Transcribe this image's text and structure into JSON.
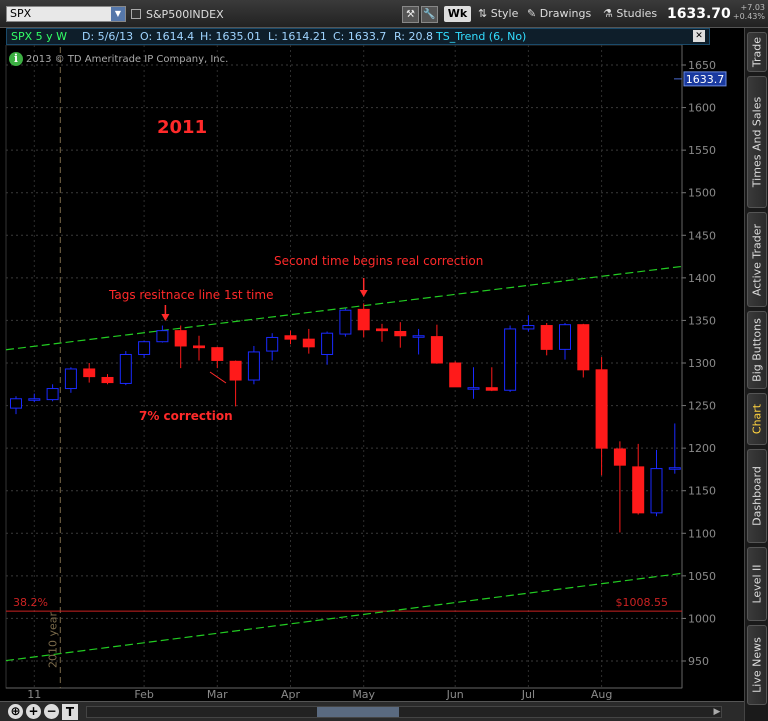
{
  "toolbar": {
    "symbol": "SPX",
    "symbol_description": "S&P500INDEX",
    "aggregation_button": "Wk",
    "style_label": "Style",
    "drawings_label": "Drawings",
    "studies_label": "Studies",
    "last_price": "1633.70",
    "net_change": "+7.03",
    "pct_change": "+0.43%"
  },
  "infobar": {
    "symbol_period": "SPX 5 y W",
    "date": "D: 5/6/13",
    "open": "O: 1614.4",
    "high": "H: 1635.01",
    "low": "L: 1614.21",
    "close": "C: 1633.7",
    "range": "R: 20.8",
    "study": "TS_Trend (6, No)"
  },
  "copyright": "2013 © TD Ameritrade IP Company, Inc.",
  "side_tabs": [
    "Trade",
    "Times And Sales",
    "Active Trader",
    "Big Buttons",
    "Chart",
    "Dashboard",
    "Level II",
    "Live News"
  ],
  "active_side_tab": "Chart",
  "colors": {
    "up_candle": "#1a2aff",
    "down_candle": "#ff1a1a",
    "trend_line": "#22cc22",
    "fib_line": "#cc2222",
    "price_axis_text": "#8a8a8a",
    "annotation_text": "#ff2a2a",
    "price_label_bg": "#1a3aa0"
  },
  "chart_data": {
    "type": "candlestick",
    "title": "2011",
    "ylim": [
      930,
      1665
    ],
    "y_ticks": [
      950,
      1000,
      1050,
      1100,
      1150,
      1200,
      1250,
      1300,
      1350,
      1400,
      1450,
      1500,
      1550,
      1600,
      1650
    ],
    "x_tick_labels": [
      "11",
      "Feb",
      "Mar",
      "Apr",
      "May",
      "Jun",
      "Jul",
      "Aug"
    ],
    "x_tick_bar_index": [
      1,
      7,
      11,
      15,
      19,
      24,
      28,
      32
    ],
    "current_price_label": "1633.7",
    "grid": true,
    "candles": [
      {
        "o": 1247,
        "h": 1261,
        "l": 1240,
        "c": 1258
      },
      {
        "o": 1257,
        "h": 1264,
        "l": 1254,
        "c": 1258
      },
      {
        "o": 1257,
        "h": 1275,
        "l": 1255,
        "c": 1270
      },
      {
        "o": 1270,
        "h": 1295,
        "l": 1265,
        "c": 1293
      },
      {
        "o": 1293,
        "h": 1300,
        "l": 1277,
        "c": 1284
      },
      {
        "o": 1283,
        "h": 1287,
        "l": 1275,
        "c": 1277
      },
      {
        "o": 1276,
        "h": 1314,
        "l": 1274,
        "c": 1310
      },
      {
        "o": 1310,
        "h": 1326,
        "l": 1306,
        "c": 1325
      },
      {
        "o": 1325,
        "h": 1344,
        "l": 1324,
        "c": 1338
      },
      {
        "o": 1338,
        "h": 1344,
        "l": 1294,
        "c": 1320
      },
      {
        "o": 1320,
        "h": 1332,
        "l": 1303,
        "c": 1318
      },
      {
        "o": 1318,
        "h": 1319,
        "l": 1294,
        "c": 1303
      },
      {
        "o": 1302,
        "h": 1303,
        "l": 1249,
        "c": 1280
      },
      {
        "o": 1280,
        "h": 1320,
        "l": 1275,
        "c": 1313
      },
      {
        "o": 1314,
        "h": 1335,
        "l": 1303,
        "c": 1330
      },
      {
        "o": 1332,
        "h": 1338,
        "l": 1322,
        "c": 1328
      },
      {
        "o": 1328,
        "h": 1340,
        "l": 1311,
        "c": 1319
      },
      {
        "o": 1310,
        "h": 1337,
        "l": 1298,
        "c": 1335
      },
      {
        "o": 1334,
        "h": 1364,
        "l": 1331,
        "c": 1362
      },
      {
        "o": 1363,
        "h": 1370,
        "l": 1330,
        "c": 1339
      },
      {
        "o": 1340,
        "h": 1346,
        "l": 1325,
        "c": 1338
      },
      {
        "o": 1337,
        "h": 1348,
        "l": 1318,
        "c": 1332
      },
      {
        "o": 1331,
        "h": 1340,
        "l": 1310,
        "c": 1332
      },
      {
        "o": 1331,
        "h": 1345,
        "l": 1299,
        "c": 1300
      },
      {
        "o": 1300,
        "h": 1302,
        "l": 1272,
        "c": 1272
      },
      {
        "o": 1271,
        "h": 1295,
        "l": 1258,
        "c": 1271
      },
      {
        "o": 1271,
        "h": 1295,
        "l": 1267,
        "c": 1268
      },
      {
        "o": 1268,
        "h": 1344,
        "l": 1266,
        "c": 1340
      },
      {
        "o": 1340,
        "h": 1356,
        "l": 1337,
        "c": 1344
      },
      {
        "o": 1344,
        "h": 1347,
        "l": 1309,
        "c": 1316
      },
      {
        "o": 1316,
        "h": 1347,
        "l": 1304,
        "c": 1345
      },
      {
        "o": 1345,
        "h": 1346,
        "l": 1283,
        "c": 1292
      },
      {
        "o": 1292,
        "h": 1307,
        "l": 1168,
        "c": 1200
      },
      {
        "o": 1199,
        "h": 1208,
        "l": 1101,
        "c": 1180
      },
      {
        "o": 1178,
        "h": 1205,
        "l": 1122,
        "c": 1124
      },
      {
        "o": 1124,
        "h": 1198,
        "l": 1120,
        "c": 1176
      },
      {
        "o": 1176,
        "h": 1229,
        "l": 1170,
        "c": 1177
      }
    ],
    "trend_lines": [
      {
        "name": "resistance",
        "points": [
          [
            0,
            1317
          ],
          [
            40,
            1423
          ]
        ]
      },
      {
        "name": "support",
        "points": [
          [
            0,
            952
          ],
          [
            40,
            1063
          ]
        ]
      }
    ],
    "fib_level": {
      "label": "38.2%",
      "value": 1008.55,
      "value_label": "$1008.55"
    },
    "vertical_marker": {
      "bar_index": 1,
      "label": "2010 year"
    },
    "annotations": [
      {
        "text": "Tags resitnace line 1st time",
        "arrow_bar": 8
      },
      {
        "text": "Second time begins real correction",
        "arrow_bar": 19
      },
      {
        "text": "7% correction",
        "pointer_bar": 12
      }
    ]
  }
}
